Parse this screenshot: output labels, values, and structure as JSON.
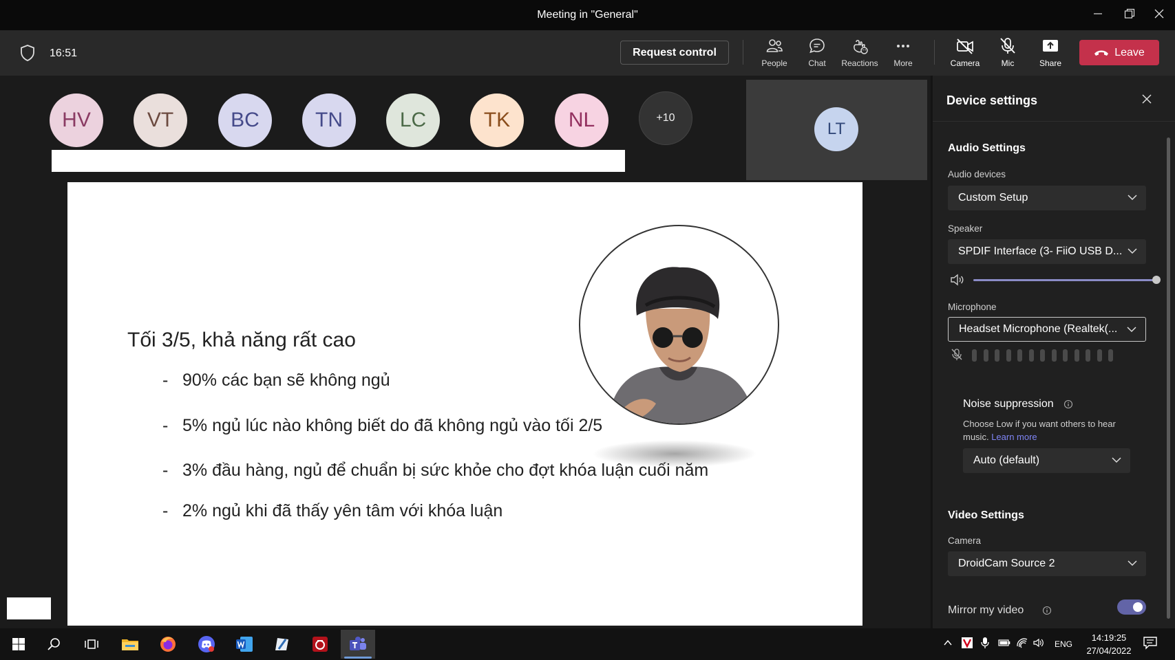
{
  "window": {
    "title": "Meeting in \"General\""
  },
  "meeting_bar": {
    "timer": "16:51",
    "request_control": "Request control",
    "tools": [
      {
        "label": "People",
        "icon": "people-icon"
      },
      {
        "label": "Chat",
        "icon": "chat-icon"
      },
      {
        "label": "Reactions",
        "icon": "reactions-icon"
      },
      {
        "label": "More",
        "icon": "more-icon"
      }
    ],
    "devices": [
      {
        "label": "Camera",
        "icon": "camera-off-icon"
      },
      {
        "label": "Mic",
        "icon": "mic-off-icon"
      },
      {
        "label": "Share",
        "icon": "share-icon"
      }
    ],
    "leave": "Leave",
    "leave_color": "#c4314b"
  },
  "participants": [
    {
      "initials": "HV",
      "bg": "#ecd2de",
      "fg": "#8a3b63"
    },
    {
      "initials": "VT",
      "bg": "#eadfdc",
      "fg": "#6b4a40"
    },
    {
      "initials": "BC",
      "bg": "#d8d8ef",
      "fg": "#454a8a"
    },
    {
      "initials": "TN",
      "bg": "#d8d8ef",
      "fg": "#454a8a"
    },
    {
      "initials": "LC",
      "bg": "#dfe6dc",
      "fg": "#4c6a48"
    },
    {
      "initials": "TK",
      "bg": "#fde3cd",
      "fg": "#8a4d1c"
    },
    {
      "initials": "NL",
      "bg": "#f7d3e2",
      "fg": "#93305f"
    }
  ],
  "more_participants": "+10",
  "featured_tile": {
    "initials": "LT"
  },
  "slide": {
    "title": "Tối 3/5, khả năng rất cao",
    "bullets": [
      "90% các bạn sẽ không ngủ",
      "5% ngủ lúc nào không biết do đã không ngủ vào tối 2/5",
      "3% đầu hàng, ngủ để chuẩn bị sức khỏe cho đợt khóa luận cuối năm",
      "2% ngủ khi đã thấy yên tâm với khóa luận"
    ]
  },
  "device_settings": {
    "title": "Device settings",
    "audio_heading": "Audio Settings",
    "audio_devices_label": "Audio devices",
    "audio_devices_value": "Custom Setup",
    "speaker_label": "Speaker",
    "speaker_value": "SPDIF Interface (3- FiiO USB D...",
    "speaker_volume": 1.0,
    "microphone_label": "Microphone",
    "microphone_value": "Headset Microphone (Realtek(...",
    "noise_label": "Noise suppression",
    "noise_desc": "Choose Low if you want others to hear music.",
    "learn_more": "Learn more",
    "noise_value": "Auto (default)",
    "video_heading": "Video Settings",
    "camera_label": "Camera",
    "camera_value": "DroidCam Source 2",
    "mirror_label": "Mirror my video",
    "mirror_on": true,
    "accent": "#6264a7"
  },
  "taskbar": {
    "language": "ENG",
    "time": "14:19:25",
    "date": "27/04/2022",
    "apps": [
      "start-icon",
      "search-icon",
      "task-view-icon",
      "file-explorer-icon",
      "firefox-icon",
      "discord-icon",
      "word-icon",
      "pen-app-icon",
      "pdf-app-icon",
      "teams-icon"
    ]
  }
}
